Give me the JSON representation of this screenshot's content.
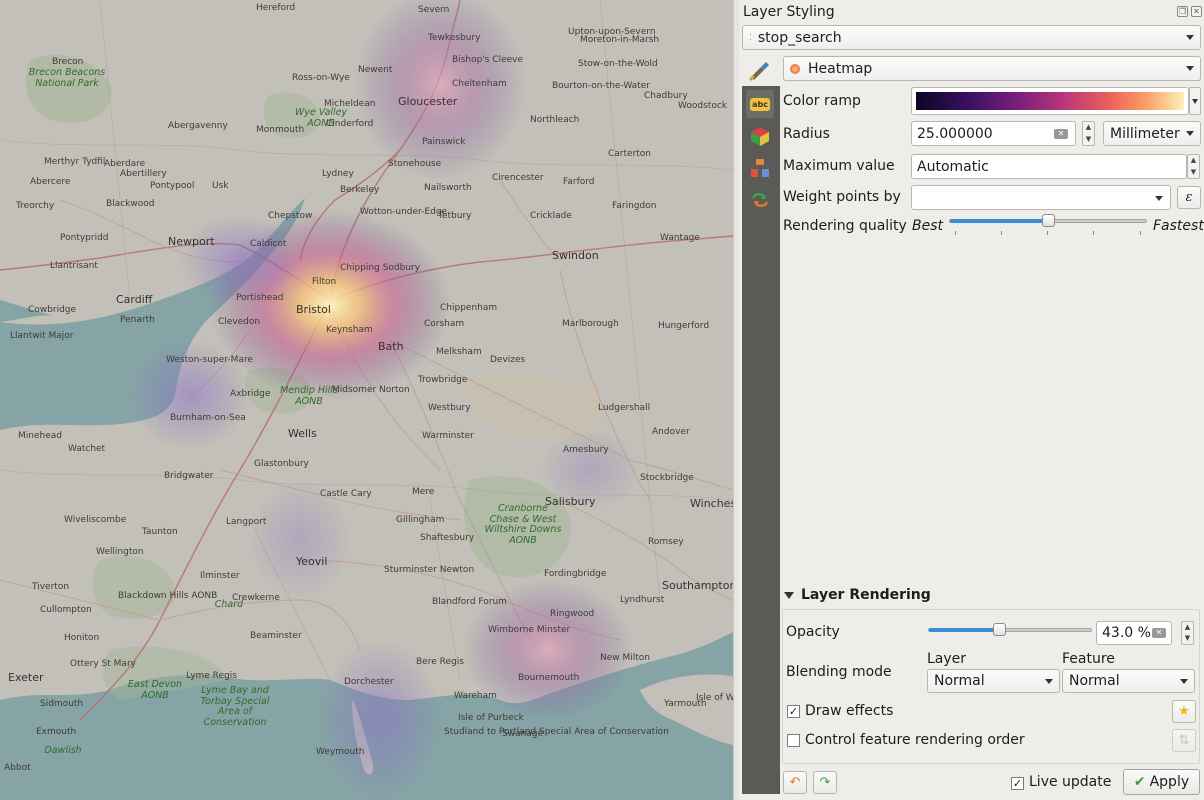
{
  "map": {
    "places": [
      {
        "name": "Hereford",
        "big": false
      },
      {
        "name": "Severn",
        "big": false
      },
      {
        "name": "Tewkesbury",
        "big": false
      },
      {
        "name": "Upton-upon-Severn",
        "big": false
      },
      {
        "name": "Brecon Beacons National Park",
        "big": false
      },
      {
        "name": "Bishop's Cleeve",
        "big": false
      },
      {
        "name": "Moreton-in-Marsh",
        "big": false
      },
      {
        "name": "Ross-on-Wye",
        "big": false
      },
      {
        "name": "Newent",
        "big": false
      },
      {
        "name": "Stow-on-the-Wold",
        "big": false
      },
      {
        "name": "Cheltenham",
        "big": false
      },
      {
        "name": "Bourton-on-the-Water",
        "big": false
      },
      {
        "name": "Brecon",
        "big": false
      },
      {
        "name": "Abergavenny",
        "big": false
      },
      {
        "name": "Micheldean",
        "big": false
      },
      {
        "name": "Gloucester",
        "big": true
      },
      {
        "name": "Chadbury",
        "big": false
      },
      {
        "name": "Woodstock",
        "big": false
      },
      {
        "name": "Wye Valley AONB",
        "big": false
      },
      {
        "name": "Monmouth",
        "big": false
      },
      {
        "name": "Cinderford",
        "big": false
      },
      {
        "name": "Northleach",
        "big": false
      },
      {
        "name": "Painswick",
        "big": false
      },
      {
        "name": "Merthyr Tydfil",
        "big": false
      },
      {
        "name": "Aberdare",
        "big": false
      },
      {
        "name": "Abertillery",
        "big": false
      },
      {
        "name": "Stonehouse",
        "big": false
      },
      {
        "name": "Carterton",
        "big": false
      },
      {
        "name": "Pontypool",
        "big": false
      },
      {
        "name": "Usk",
        "big": false
      },
      {
        "name": "Lydney",
        "big": false
      },
      {
        "name": "Cirencester",
        "big": false
      },
      {
        "name": "Abercere",
        "big": false
      },
      {
        "name": "Nailsworth",
        "big": false
      },
      {
        "name": "Berkeley",
        "big": false
      },
      {
        "name": "Farford",
        "big": false
      },
      {
        "name": "Treorchy",
        "big": false
      },
      {
        "name": "Blackwood",
        "big": false
      },
      {
        "name": "Faringdon",
        "big": false
      },
      {
        "name": "Wotton-under-Edge",
        "big": false
      },
      {
        "name": "Tetbury",
        "big": false
      },
      {
        "name": "Chepstow",
        "big": false
      },
      {
        "name": "Cricklade",
        "big": false
      },
      {
        "name": "Pontypridd",
        "big": false
      },
      {
        "name": "Newport",
        "big": true
      },
      {
        "name": "Wantage",
        "big": false
      },
      {
        "name": "Caldicot",
        "big": false
      },
      {
        "name": "Swindon",
        "big": true
      },
      {
        "name": "Chipping Sodbury",
        "big": false
      },
      {
        "name": "Llantrisant",
        "big": false
      },
      {
        "name": "Portishead",
        "big": false
      },
      {
        "name": "Filton",
        "big": false
      },
      {
        "name": "Cardiff",
        "big": true
      },
      {
        "name": "Cowbridge",
        "big": false
      },
      {
        "name": "Chippenham",
        "big": false
      },
      {
        "name": "Penarth",
        "big": false
      },
      {
        "name": "Clevedon",
        "big": false
      },
      {
        "name": "Bristol",
        "big": true
      },
      {
        "name": "Marlborough",
        "big": false
      },
      {
        "name": "Hungerford",
        "big": false
      },
      {
        "name": "Llantwit Major",
        "big": false
      },
      {
        "name": "Keynsham",
        "big": false
      },
      {
        "name": "Corsham",
        "big": false
      },
      {
        "name": "Bath",
        "big": true
      },
      {
        "name": "Melksham",
        "big": false
      },
      {
        "name": "Devizes",
        "big": false
      },
      {
        "name": "Weston-super-Mare",
        "big": false
      },
      {
        "name": "Trowbridge",
        "big": false
      },
      {
        "name": "Midsomer Norton",
        "big": false
      },
      {
        "name": "Axbridge",
        "big": false
      },
      {
        "name": "Mendip Hills AONB",
        "big": false
      },
      {
        "name": "Ludgershall",
        "big": false
      },
      {
        "name": "Burnham-on-Sea",
        "big": false
      },
      {
        "name": "Westbury",
        "big": false
      },
      {
        "name": "Wells",
        "big": true
      },
      {
        "name": "Warminster",
        "big": false
      },
      {
        "name": "Andover",
        "big": false
      },
      {
        "name": "Minehead",
        "big": false
      },
      {
        "name": "Watchet",
        "big": false
      },
      {
        "name": "Amesbury",
        "big": false
      },
      {
        "name": "Glastonbury",
        "big": false
      },
      {
        "name": "Bridgwater",
        "big": false
      },
      {
        "name": "Stockbridge",
        "big": false
      },
      {
        "name": "Castle Cary",
        "big": false
      },
      {
        "name": "Mere",
        "big": false
      },
      {
        "name": "Salisbury",
        "big": true
      },
      {
        "name": "Winchester",
        "big": true
      },
      {
        "name": "Wiveliscombe",
        "big": false
      },
      {
        "name": "Langport",
        "big": false
      },
      {
        "name": "Gillingham",
        "big": false
      },
      {
        "name": "Cranborne Chase & West Wiltshire Downs AONB",
        "big": false
      },
      {
        "name": "Romsey",
        "big": false
      },
      {
        "name": "Taunton",
        "big": false
      },
      {
        "name": "Shaftesbury",
        "big": false
      },
      {
        "name": "Wellington",
        "big": false
      },
      {
        "name": "Yeovil",
        "big": true
      },
      {
        "name": "Sturminster Newton",
        "big": false
      },
      {
        "name": "Fordingbridge",
        "big": false
      },
      {
        "name": "Southampton",
        "big": true
      },
      {
        "name": "Tiverton",
        "big": false
      },
      {
        "name": "Ilminster",
        "big": false
      },
      {
        "name": "Crewkerne",
        "big": false
      },
      {
        "name": "Ringwood",
        "big": false
      },
      {
        "name": "Lyndhurst",
        "big": false
      },
      {
        "name": "Cullompton",
        "big": false
      },
      {
        "name": "Blackdown Hills AONB",
        "big": false
      },
      {
        "name": "Chard",
        "big": false
      },
      {
        "name": "Blandford Forum",
        "big": false
      },
      {
        "name": "Beaminster",
        "big": false
      },
      {
        "name": "Wimborne Minster",
        "big": false
      },
      {
        "name": "Honiton",
        "big": false
      },
      {
        "name": "Ottery St Mary",
        "big": false
      },
      {
        "name": "Bere Regis",
        "big": false
      },
      {
        "name": "New Milton",
        "big": false
      },
      {
        "name": "Exeter",
        "big": true
      },
      {
        "name": "East Devon AONB",
        "big": false
      },
      {
        "name": "Lyme Regis",
        "big": false
      },
      {
        "name": "Dorchester",
        "big": false
      },
      {
        "name": "Bournemouth",
        "big": false
      },
      {
        "name": "Lyme Bay and Torbay Special Area of Conservation",
        "big": false
      },
      {
        "name": "Sidmouth",
        "big": false
      },
      {
        "name": "Wareham",
        "big": false
      },
      {
        "name": "Exmouth",
        "big": false
      },
      {
        "name": "Weymouth",
        "big": false
      },
      {
        "name": "Isle of Purbeck",
        "big": false
      },
      {
        "name": "Swanage",
        "big": false
      },
      {
        "name": "Dawlish",
        "big": false
      },
      {
        "name": "Studland to Portland Special Area of Conservation",
        "big": false
      },
      {
        "name": "Abbot",
        "big": false
      },
      {
        "name": "Yarmouth",
        "big": false
      },
      {
        "name": "Isle of Wight",
        "big": false
      }
    ]
  },
  "panel": {
    "title": "Layer Styling",
    "layer_select": "stop_search",
    "renderer_select": "Heatmap",
    "color_ramp_label": "Color ramp",
    "radius_label": "Radius",
    "radius_value": "25.000000",
    "radius_unit": "Millimeter",
    "max_value_label": "Maximum value",
    "max_value": "Automatic",
    "weight_label": "Weight points by",
    "weight_value": "",
    "quality_label": "Rendering quality",
    "quality_best": "Best",
    "quality_fastest": "Fastest",
    "quality_level": 0.5,
    "expression_symbol": "ε"
  },
  "rendering": {
    "section_title": "Layer Rendering",
    "opacity_label": "Opacity",
    "opacity_value": "43.0 %",
    "opacity_fraction": 0.43,
    "blending_label": "Blending mode",
    "layer_col": "Layer",
    "feature_col": "Feature",
    "layer_blend": "Normal",
    "feature_blend": "Normal",
    "draw_effects_label": "Draw effects",
    "draw_effects_checked": true,
    "control_order_label": "Control feature rendering order",
    "control_order_checked": false
  },
  "footer": {
    "live_update_label": "Live update",
    "live_update_checked": true,
    "apply_label": "Apply"
  },
  "colors": {
    "accent": "#3d8ad6",
    "panel_bg": "#efedea",
    "sidebar": "#5a5a57",
    "heat_low": "#3b1c5e",
    "heat_high": "#fff6c0"
  }
}
